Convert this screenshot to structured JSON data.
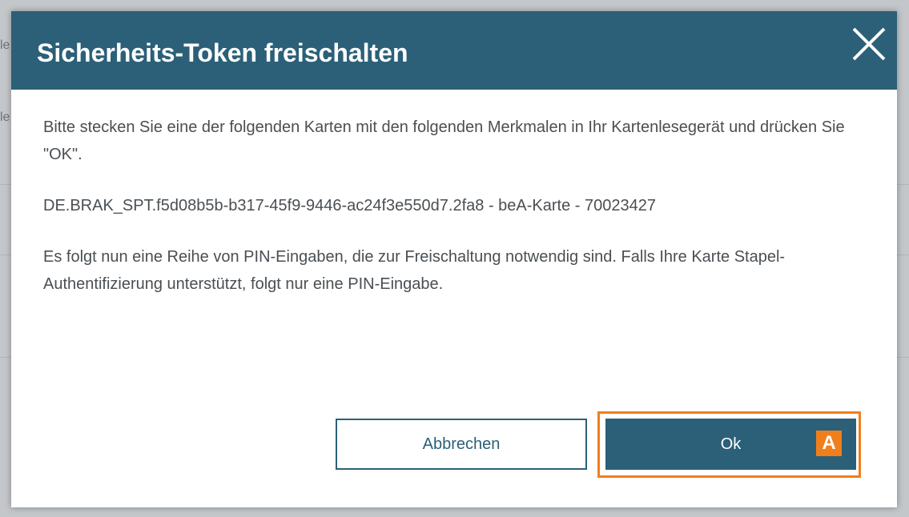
{
  "dialog": {
    "title": "Sicherheits-Token freischalten",
    "paragraphs": [
      "Bitte stecken Sie eine der folgenden Karten mit den folgenden Merkmalen in Ihr Kartenlesegerät und drücken Sie \"OK\".",
      "DE.BRAK_SPT.f5d08b5b-b317-45f9-9446-ac24f3e550d7.2fa8 - beA-Karte - 70023427",
      "Es folgt nun eine Reihe von PIN-Eingaben, die zur Freischaltung notwendig sind. Falls Ihre Karte Stapel-Authentifizierung unterstützt, folgt nur eine PIN-Eingabe."
    ],
    "buttons": {
      "cancel": "Abbrechen",
      "ok": "Ok"
    },
    "annotation_badge": "A",
    "close_icon": "close-icon"
  },
  "colors": {
    "header": "#2b6078",
    "highlight": "#f07f1b",
    "body_text": "#4a4f53"
  }
}
